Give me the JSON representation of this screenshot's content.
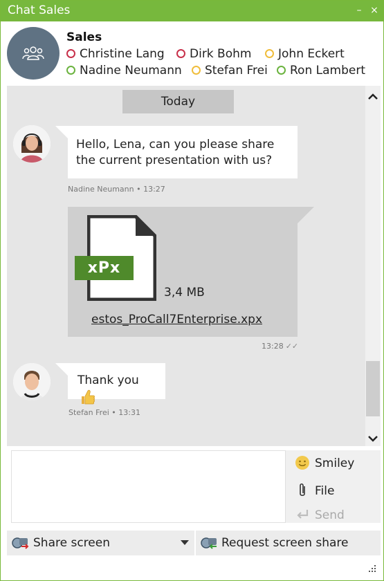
{
  "window": {
    "title": "Chat Sales",
    "minimize_glyph": "–",
    "close_glyph": "×"
  },
  "header": {
    "group_name": "Sales",
    "avatar_icon": "group-icon",
    "participants": [
      {
        "name": "Christine Lang",
        "status": "busy"
      },
      {
        "name": "Dirk Bohm",
        "status": "busy"
      },
      {
        "name": "John Eckert",
        "status": "away"
      },
      {
        "name": "Nadine Neumann",
        "status": "online"
      },
      {
        "name": "Stefan Frei",
        "status": "away"
      },
      {
        "name": "Ron Lambert",
        "status": "online"
      }
    ]
  },
  "chat": {
    "date_separator": "Today",
    "messages": [
      {
        "text": "Hello, Lena, can you please share the current presentation with us?",
        "meta": "Nadine Neumann • 13:27"
      },
      {
        "file_badge": "xPx",
        "file_size": "3,4 MB",
        "file_name": "estos_ProCall7Enterprise.xpx",
        "meta": "13:28"
      },
      {
        "text": "Thank you",
        "meta": "Stefan Frei • 13:31"
      }
    ]
  },
  "composer": {
    "actions": {
      "smiley": "Smiley",
      "file": "File",
      "send": "Send"
    }
  },
  "toolbar": {
    "share_screen": "Share screen",
    "request_screen_share": "Request screen share"
  },
  "colors": {
    "accent": "#77b83d",
    "busy": "#c8304a",
    "away": "#f0bd3b",
    "online": "#6bb33f",
    "file_badge": "#4f8a2b"
  }
}
